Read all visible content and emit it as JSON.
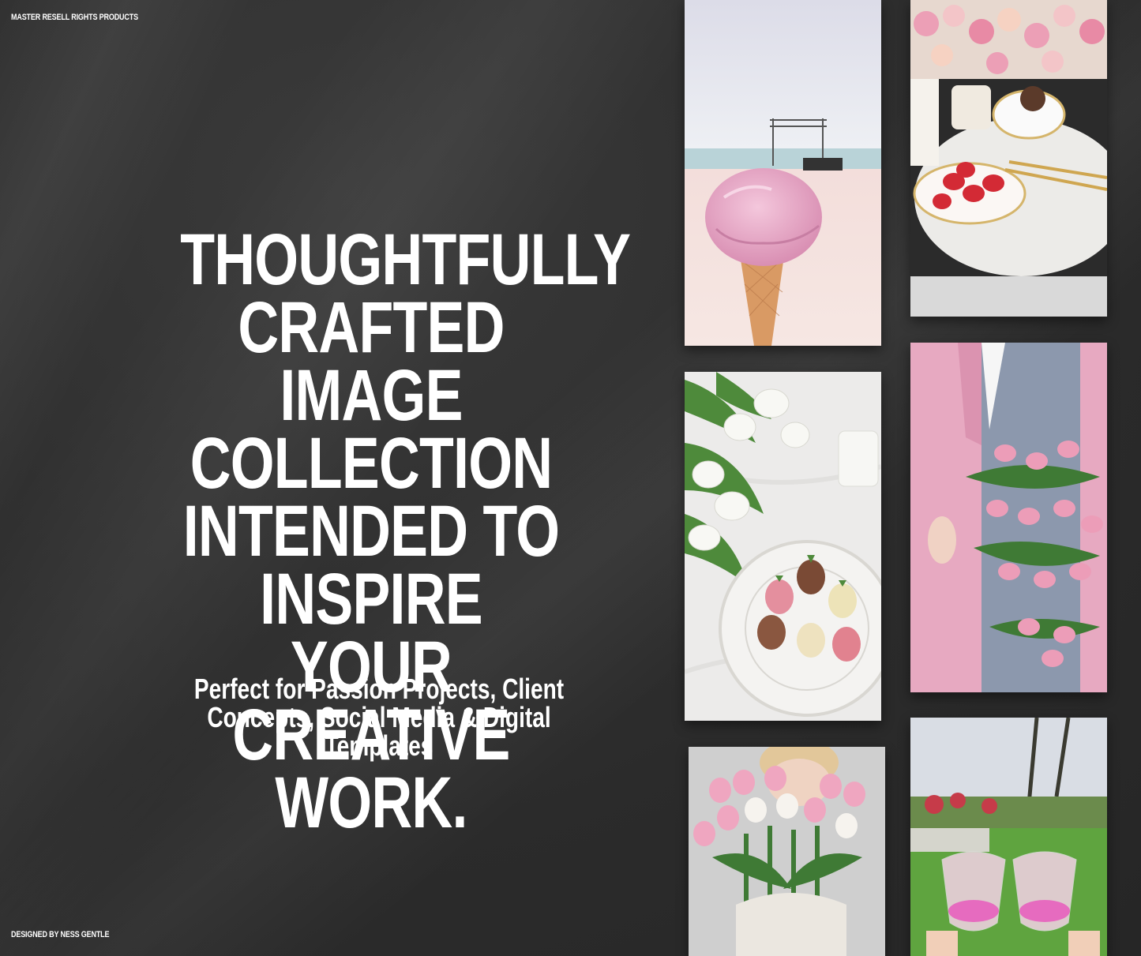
{
  "header": {
    "brand_text": "MASTER RESELL RIGHTS PRODUCTS"
  },
  "main": {
    "headline_lines": [
      "THOUGHTFULLY",
      "CRAFTED IMAGE",
      "COLLECTION",
      "INTENDED TO",
      "INSPIRE YOUR",
      "CREATIVE WORK."
    ],
    "subline_lines": [
      "Perfect for Passion Projects, Client",
      "Concepts, Social Media & Digital Templates"
    ]
  },
  "footer": {
    "credit_text": "DESIGNED BY NESS GENTLE"
  },
  "colors": {
    "background": "#2e2e2e",
    "text": "#ffffff",
    "accent_pink": "#e8a7c3"
  }
}
